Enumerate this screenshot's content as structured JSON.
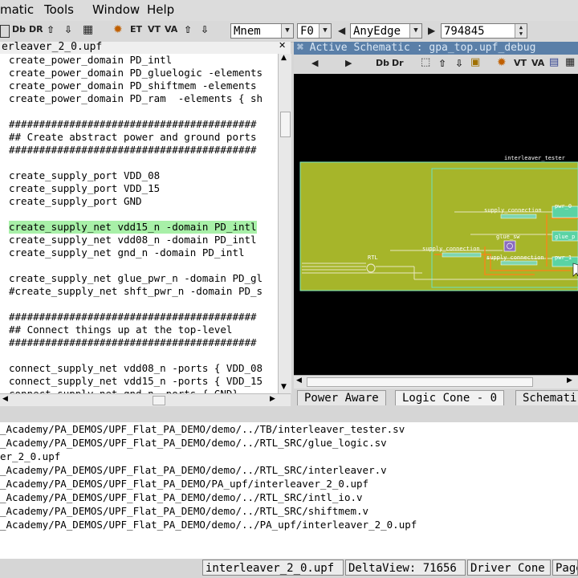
{
  "menubar": {
    "items": [
      "matic",
      "Tools",
      "Window",
      "Help"
    ]
  },
  "toolbar": {
    "icon_labels": [
      "ET",
      "VT",
      "VA"
    ],
    "mnemonic_select": "Mnem",
    "f_select": "F0",
    "edge_select": "AnyEdge",
    "time_value": "794845"
  },
  "editor": {
    "tab_title": "erleaver_2_0.upf",
    "lines": [
      {
        "text": "create_power_domain PD_intl"
      },
      {
        "text": "create_power_domain PD_gluelogic -elements"
      },
      {
        "text": "create_power_domain PD_shiftmem -elements"
      },
      {
        "text": "create_power_domain PD_ram  -elements { sh"
      },
      {
        "text": ""
      },
      {
        "text": "#########################################"
      },
      {
        "text": "## Create abstract power and ground ports"
      },
      {
        "text": "#########################################"
      },
      {
        "text": ""
      },
      {
        "text": "create_supply_port VDD_08"
      },
      {
        "text": "create_supply_port VDD_15"
      },
      {
        "text": "create_supply_port GND"
      },
      {
        "text": ""
      },
      {
        "text": "create_supply_net vdd15_n -domain PD_intl",
        "highlight": true
      },
      {
        "text": "create_supply_net vdd08_n -domain PD_intl"
      },
      {
        "text": "create_supply_net gnd_n -domain PD_intl"
      },
      {
        "text": ""
      },
      {
        "text": "create_supply_net glue_pwr_n -domain PD_gl"
      },
      {
        "text": "#create_supply_net shft_pwr_n -domain PD_s"
      },
      {
        "text": ""
      },
      {
        "text": "#########################################"
      },
      {
        "text": "## Connect things up at the top-level"
      },
      {
        "text": "#########################################"
      },
      {
        "text": ""
      },
      {
        "text": "connect_supply_net vdd08_n -ports { VDD_08"
      },
      {
        "text": "connect_supply_net vdd15_n -ports { VDD_15"
      },
      {
        "text": "connect_supply_net gnd_n -ports { GND}"
      }
    ]
  },
  "schematic": {
    "title": "Active Schematic : gpa_top.upf_debug",
    "toolbar_labels": [
      "VT",
      "VA"
    ],
    "labels": {
      "tester": "interleaver_tester",
      "rtl": "RTL",
      "glue": "glue_sw",
      "supply1": "supply_connection",
      "supply2": "supply_connection",
      "supply3": "supply_connection",
      "pwr1": "pwr_0",
      "pwr2": "glue_p",
      "pwr3": "pwr_1"
    },
    "tabs": [
      "Power Aware",
      "Logic Cone - 0",
      "Schemati"
    ]
  },
  "transcript": {
    "lines": [
      "_Academy/PA_DEMOS/UPF_Flat_PA_DEMO/demo/../TB/interleaver_tester.sv",
      "_Academy/PA_DEMOS/UPF_Flat_PA_DEMO/demo/../RTL_SRC/glue_logic.sv",
      "er_2_0.upf",
      "_Academy/PA_DEMOS/UPF_Flat_PA_DEMO/demo/../RTL_SRC/interleaver.v",
      "_Academy/PA_DEMOS/UPF_Flat_PA_DEMO/PA_upf/interleaver_2_0.upf",
      "_Academy/PA_DEMOS/UPF_Flat_PA_DEMO/demo/../RTL_SRC/intl_io.v",
      "_Academy/PA_DEMOS/UPF_Flat_PA_DEMO/demo/../RTL_SRC/shiftmem.v",
      "_Academy/PA_DEMOS/UPF_Flat_PA_DEMO/demo/../PA_upf/interleaver_2_0.upf"
    ]
  },
  "statusbar": {
    "file": "interleaver_2_0.upf",
    "deltaview": "DeltaView: 71656",
    "driver": "Driver Cone",
    "page": "Page"
  },
  "colors": {
    "highlight": "#a8f0a8",
    "schematic_bg": "#000000",
    "schematic_block": "#a6b52a",
    "title_bar": "#5a7fa8"
  }
}
